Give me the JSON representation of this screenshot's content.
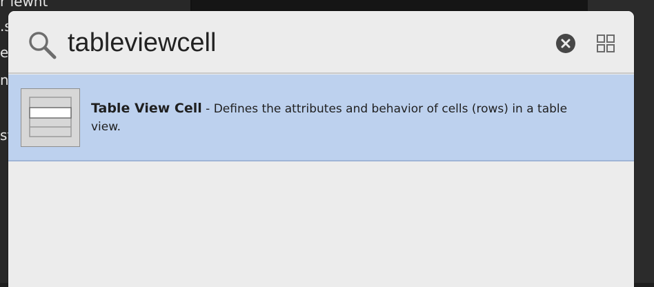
{
  "background": {
    "left_fragments": [
      "r lewnt",
      ".s",
      "e",
      "n",
      "st"
    ]
  },
  "search": {
    "value": "tableviewcell",
    "placeholder": ""
  },
  "results": [
    {
      "title": "Table View Cell",
      "separator": " - ",
      "description": "Defines the attributes and behavior of cells (rows) in a table view.",
      "icon": "table-view-cell-icon"
    }
  ],
  "colors": {
    "panel_bg": "#ececec",
    "selected_row": "#bdd1ee",
    "clear_button": "#474747"
  }
}
